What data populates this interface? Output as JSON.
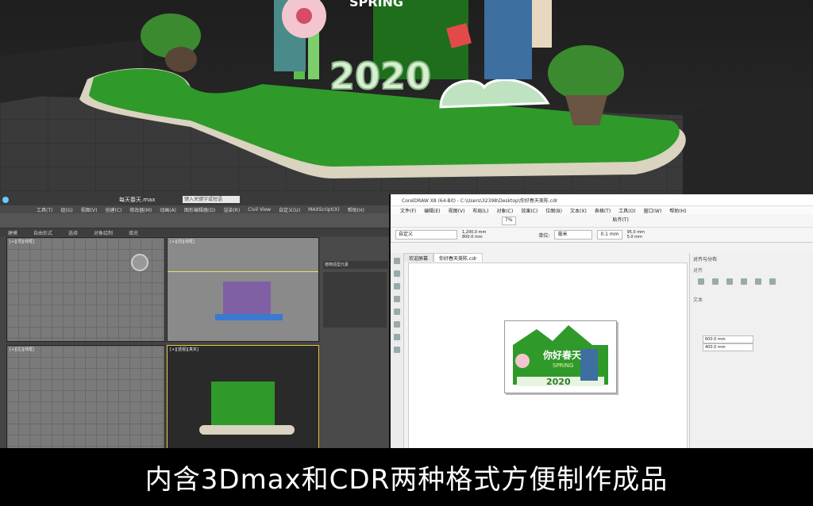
{
  "max": {
    "title": "每天春天.max",
    "search_placeholder": "键入关键字或短语",
    "menu": [
      "工具(T)",
      "组(G)",
      "视图(V)",
      "创建(C)",
      "修改器(M)",
      "动画(A)",
      "图形编辑器(D)",
      "渲染(R)",
      "Civil View",
      "自定义(U)",
      "MAXScript(X)",
      "帮助(H)"
    ],
    "ribbon": [
      "建模",
      "自由形式",
      "选择",
      "对象绘制",
      "填充"
    ],
    "viewports": [
      "[+][顶][线框]",
      "[+][前][线框]",
      "[+][左][线框]",
      "[+][透视][真实]"
    ],
    "panel_field": "植物造型元素"
  },
  "cdr": {
    "title": "CorelDRAW X8 (64-Bit) - C:\\Users\\32398\\Desktop\\你好春天美陈.cdr",
    "menu": [
      "文件(F)",
      "编辑(E)",
      "视图(V)",
      "布局(L)",
      "对象(C)",
      "效果(C)",
      "位图(B)",
      "文本(X)",
      "表格(T)",
      "工具(O)",
      "窗口(W)",
      "帮助(H)"
    ],
    "preset": "自定义",
    "width": "1,200.0 mm",
    "height": "800.0 mm",
    "units_label": "单位:",
    "units": "毫米",
    "nudge": "0.1 mm",
    "dup_x": "95.0 mm",
    "dup_y": "5.0 mm",
    "zoom": "7%",
    "snap": "贴齐(T)",
    "tab_welcome": "欢迎屏幕",
    "tab_file": "你好春天美陈.cdr",
    "docker_title": "对齐与分布",
    "docker_align": "对齐",
    "docker_text": "文本",
    "docker_pos_x": "600.0 mm",
    "docker_pos_y": "400.0 mm",
    "art_title": "你好春天",
    "art_sub": "SPRING",
    "art_year": "2020"
  },
  "hero": {
    "year": "2020",
    "sign": "SPRING"
  },
  "banner": "内含3Dmax和CDR两种格式方便制作成品",
  "colors": {
    "grass": "#2f9a2a",
    "grass_dark": "#1f6e1c",
    "base": "#d9d3c0",
    "max_bg": "#444444",
    "cdr_accent": "#2a8c3a"
  }
}
